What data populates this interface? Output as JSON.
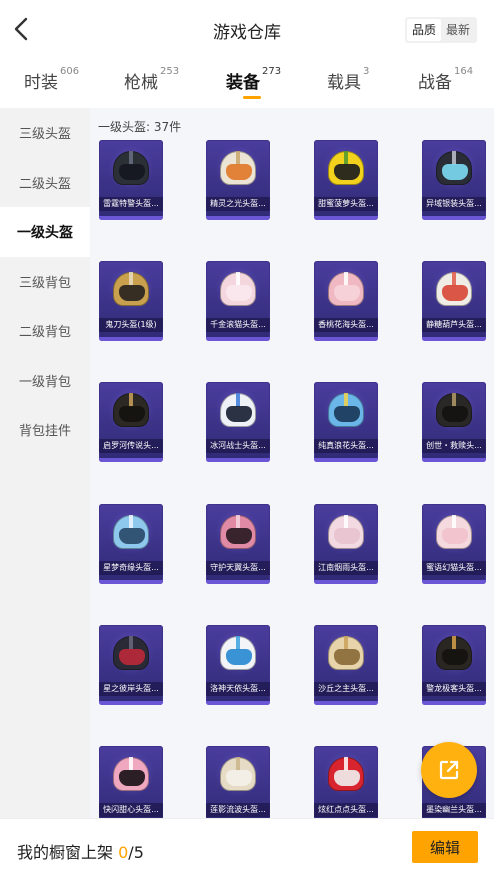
{
  "header": {
    "title": "游戏仓库",
    "sort_options": [
      "品质",
      "最新"
    ],
    "sort_selected": "品质"
  },
  "tabs": [
    {
      "label": "时装",
      "count": "606"
    },
    {
      "label": "枪械",
      "count": "253"
    },
    {
      "label": "装备",
      "count": "273",
      "active": true
    },
    {
      "label": "载具",
      "count": "3"
    },
    {
      "label": "战备",
      "count": "164"
    }
  ],
  "sidebar": {
    "items": [
      "三级头盔",
      "二级头盔",
      "一级头盔",
      "三级背包",
      "二级背包",
      "一级背包",
      "背包挂件"
    ],
    "active": "一级头盔"
  },
  "content": {
    "section_label": "一级头盔: 37件",
    "items": [
      {
        "name": "雷霆特警头盔...",
        "helmet": "#2b2f36",
        "visor": "#151820",
        "stripe": "#6a7080"
      },
      {
        "name": "精灵之光头盔...",
        "helmet": "#ece4d4",
        "visor": "#e07a2a",
        "stripe": "#c9a46a"
      },
      {
        "name": "甜蜜菠萝头盔...",
        "helmet": "#f2d21c",
        "visor": "#1d1d1d",
        "stripe": "#4a9a2e"
      },
      {
        "name": "异域银装头盔...",
        "helmet": "#2a2d36",
        "visor": "#7bd8f0",
        "stripe": "#c0c6d0"
      },
      {
        "name": "鬼刀头盔(1级)",
        "helmet": "#c9a14e",
        "visor": "#2a2420",
        "stripe": "#e8dcc0"
      },
      {
        "name": "千金滚猫头盔...",
        "helmet": "#f4d6de",
        "visor": "#f8e8ee",
        "stripe": "#ffffff"
      },
      {
        "name": "香桃花海头盔...",
        "helmet": "#f0b8c2",
        "visor": "#f7d2da",
        "stripe": "#ffffff"
      },
      {
        "name": "静糖葫芦头盔...",
        "helmet": "#f0ece6",
        "visor": "#d84a3a",
        "stripe": "#e05a48"
      },
      {
        "name": "启罗河传说头...",
        "helmet": "#2c2924",
        "visor": "#14120f",
        "stripe": "#c9a25a"
      },
      {
        "name": "冰河战士头盔...",
        "helmet": "#eef2f6",
        "visor": "#1a2233",
        "stripe": "#3a7ad8"
      },
      {
        "name": "纯真浪花头盔...",
        "helmet": "#6ab6e8",
        "visor": "#1a3a5a",
        "stripe": "#f2d24a"
      },
      {
        "name": "创世・救赎头...",
        "helmet": "#2a2826",
        "visor": "#141210",
        "stripe": "#b49a6a"
      },
      {
        "name": "星梦奇缘头盔...",
        "helmet": "#8ec8ec",
        "visor": "#2a4a6a",
        "stripe": "#f0f6ff"
      },
      {
        "name": "守护天翼头盔...",
        "helmet": "#e08aa6",
        "visor": "#2a1a22",
        "stripe": "#f6d2de"
      },
      {
        "name": "江南烟雨头盔...",
        "helmet": "#f3d9e2",
        "visor": "#e8c2cf",
        "stripe": "#ffffff"
      },
      {
        "name": "蜜语幻猫头盔...",
        "helmet": "#f4dade",
        "visor": "#f0c2cc",
        "stripe": "#ffffff"
      },
      {
        "name": "星之彼岸头盔...",
        "helmet": "#2a2a36",
        "visor": "#b8283a",
        "stripe": "#6a6a80"
      },
      {
        "name": "洛神天依头盔...",
        "helmet": "#f2f4f8",
        "visor": "#2a8ad0",
        "stripe": "#3aa0e0"
      },
      {
        "name": "沙丘之主头盔...",
        "helmet": "#e8d4aa",
        "visor": "#8a6a3a",
        "stripe": "#c9a25a"
      },
      {
        "name": "警龙极客头盔...",
        "helmet": "#2a2622",
        "visor": "#151210",
        "stripe": "#d8a04a"
      },
      {
        "name": "快闪甜心头盔...",
        "helmet": "#f0a8c0",
        "visor": "#1a1418",
        "stripe": "#ffffff"
      },
      {
        "name": "莲影流波头盔...",
        "helmet": "#e6dcc6",
        "visor": "#f4f0e8",
        "stripe": "#c9b48a"
      },
      {
        "name": "炫红点点头盔...",
        "helmet": "#d8242e",
        "visor": "#f0ecec",
        "stripe": "#ffffff"
      },
      {
        "name": "墨染幽兰头盔...",
        "helmet": "#2a2628",
        "visor": "#e8c2cc",
        "stripe": "#f0a8b8"
      }
    ]
  },
  "fab": {
    "icon": "share-external-icon"
  },
  "bottom_bar": {
    "shelf_label": "我的橱窗上架",
    "shelf_current": "0",
    "shelf_total": "/5",
    "edit_label": "编辑"
  },
  "colors": {
    "accent": "#ffa300",
    "card_bg": "#3a3290",
    "fab": "#ffb10f"
  }
}
